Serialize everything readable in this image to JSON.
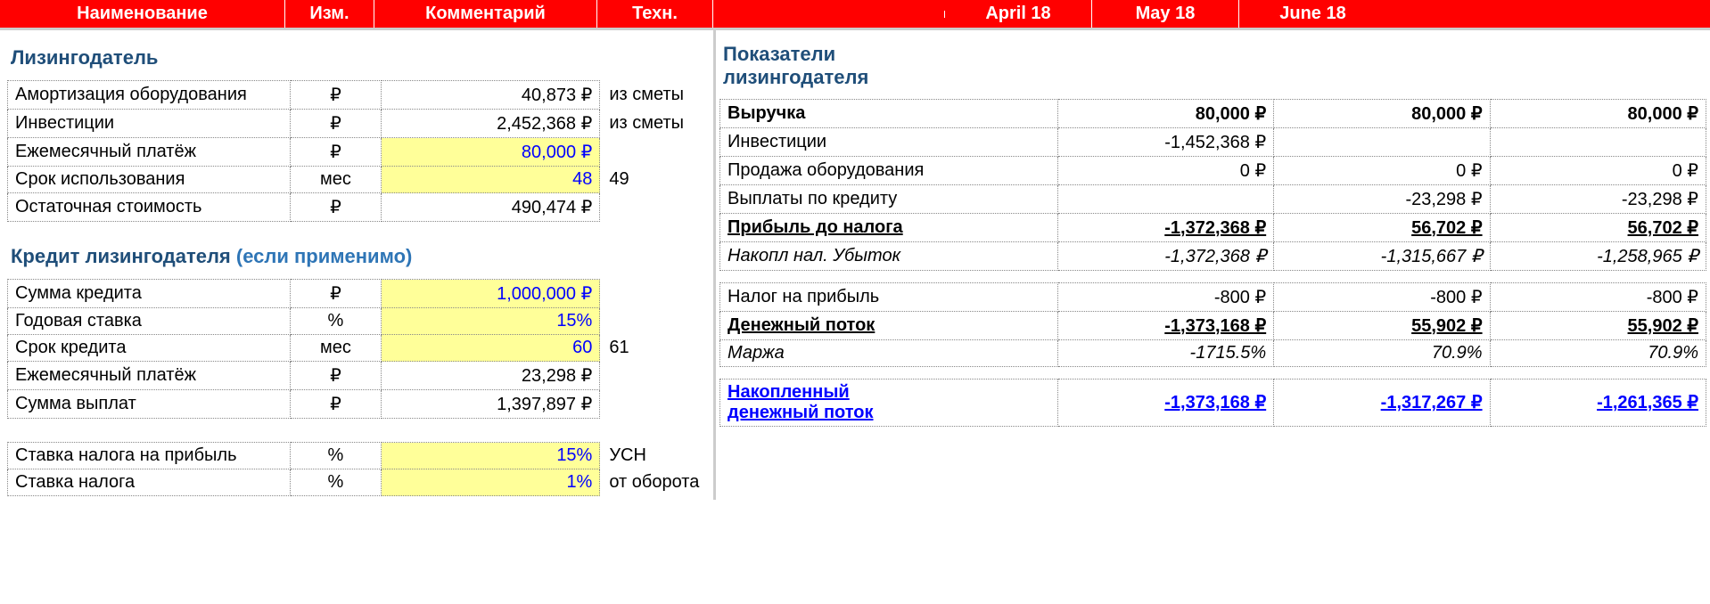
{
  "header": {
    "c1": "Наименование",
    "c2": "Изм.",
    "c3": "Комментарий",
    "c4": "Техн.",
    "months": [
      "April 18",
      "May 18",
      "June 18"
    ]
  },
  "left": {
    "section1_title": "Лизингодатель",
    "rows1": [
      {
        "label": "Амортизация оборудования",
        "unit": "₽",
        "val": "40,873 ₽",
        "tech": "из сметы",
        "yellow": false,
        "blue": false
      },
      {
        "label": "Инвестиции",
        "unit": "₽",
        "val": "2,452,368 ₽",
        "tech": "из сметы",
        "yellow": false,
        "blue": false
      },
      {
        "label": "Ежемесячный платёж",
        "unit": "₽",
        "val": "80,000 ₽",
        "tech": "",
        "yellow": true,
        "blue": true
      },
      {
        "label": "Срок использования",
        "unit": "мес",
        "val": "48",
        "tech": "49",
        "yellow": true,
        "blue": true
      },
      {
        "label": "Остаточная стоимость",
        "unit": "₽",
        "val": "490,474 ₽",
        "tech": "",
        "yellow": false,
        "blue": false
      }
    ],
    "section2_title": "Кредит лизингодателя ",
    "section2_sub": "(если применимо)",
    "rows2": [
      {
        "label": "Сумма кредита",
        "unit": "₽",
        "val": "1,000,000 ₽",
        "tech": "",
        "yellow": true,
        "blue": true
      },
      {
        "label": "Годовая ставка",
        "unit": "%",
        "val": "15%",
        "tech": "",
        "yellow": true,
        "blue": true
      },
      {
        "label": "Срок кредита",
        "unit": "мес",
        "val": "60",
        "tech": "61",
        "yellow": true,
        "blue": true
      },
      {
        "label": "Ежемесячный платёж",
        "unit": "₽",
        "val": "23,298 ₽",
        "tech": "",
        "yellow": false,
        "blue": false
      },
      {
        "label": "Сумма выплат",
        "unit": "₽",
        "val": "1,397,897 ₽",
        "tech": "",
        "yellow": false,
        "blue": false
      }
    ],
    "rows3": [
      {
        "label": "Ставка налога на прибыль",
        "unit": "%",
        "val": "15%",
        "tech": "УСН",
        "yellow": true,
        "blue": true
      },
      {
        "label": "Ставка налога",
        "unit": "%",
        "val": "1%",
        "tech": "от оборота",
        "yellow": true,
        "blue": true
      }
    ]
  },
  "right": {
    "section_title_l1": "Показатели",
    "section_title_l2": "лизингодателя",
    "rows": [
      {
        "label": "Выручка",
        "vals": [
          "80,000 ₽",
          "80,000 ₽",
          "80,000 ₽"
        ],
        "style": "bold"
      },
      {
        "label": "Инвестиции",
        "vals": [
          "-1,452,368 ₽",
          "",
          ""
        ],
        "style": ""
      },
      {
        "label": "Продажа оборудования",
        "vals": [
          "0 ₽",
          "0 ₽",
          "0 ₽"
        ],
        "style": ""
      },
      {
        "label": "Выплаты по кредиту",
        "vals": [
          "",
          "-23,298 ₽",
          "-23,298 ₽"
        ],
        "style": ""
      },
      {
        "label": "Прибыль до налога",
        "vals": [
          "-1,372,368 ₽",
          "56,702 ₽",
          "56,702 ₽"
        ],
        "style": "bu"
      },
      {
        "label": "Накопл нал. Убыток",
        "vals": [
          "-1,372,368 ₽",
          "-1,315,667 ₽",
          "-1,258,965 ₽"
        ],
        "style": "italic"
      }
    ],
    "rows2": [
      {
        "label": "Налог на прибыль",
        "vals": [
          "-800 ₽",
          "-800 ₽",
          "-800 ₽"
        ],
        "style": ""
      },
      {
        "label": "Денежный поток",
        "vals": [
          "-1,373,168 ₽",
          "55,902 ₽",
          "55,902 ₽"
        ],
        "style": "bu"
      },
      {
        "label": "Маржа",
        "vals": [
          "-1715.5%",
          "70.9%",
          "70.9%"
        ],
        "style": "italic"
      }
    ],
    "cumflow": {
      "label_l1": "Накопленный",
      "label_l2": "денежный поток",
      "vals": [
        "-1,373,168 ₽",
        "-1,317,267 ₽",
        "-1,261,365 ₽"
      ]
    }
  }
}
